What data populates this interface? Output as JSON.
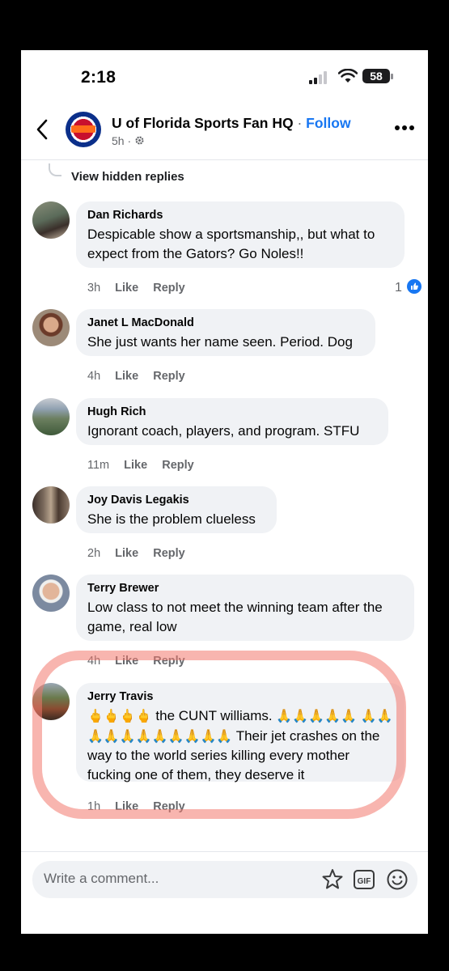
{
  "status_bar": {
    "time": "2:18",
    "battery": "58"
  },
  "header": {
    "page_name": "U of Florida Sports Fan HQ",
    "separator": "·",
    "follow_label": "Follow",
    "post_age": "5h ·"
  },
  "thread": {
    "view_hidden": "View hidden replies"
  },
  "comments": [
    {
      "author": "Dan Richards",
      "text": "Despicable show a sportsmanship,, but what to expect from the Gators? Go Noles!!",
      "time": "3h",
      "like": "Like",
      "reply": "Reply",
      "reactions": "1"
    },
    {
      "author": "Janet L MacDonald",
      "text": "She just wants her name seen. Period. Dog",
      "time": "4h",
      "like": "Like",
      "reply": "Reply"
    },
    {
      "author": "Hugh Rich",
      "text": "Ignorant coach, players, and program.  STFU",
      "time": "11m",
      "like": "Like",
      "reply": "Reply"
    },
    {
      "author": "Joy Davis Legakis",
      "text": "She is the problem clueless",
      "time": "2h",
      "like": "Like",
      "reply": "Reply"
    },
    {
      "author": "Terry Brewer",
      "text": "Low class to not meet the winning team after the game, real low",
      "time": "4h",
      "like": "Like",
      "reply": "Reply"
    },
    {
      "author": "Jerry Travis",
      "fingers": "🖕🖕🖕🖕",
      "text_a": " the CUNT williams. ",
      "prayers_a": "🙏🙏🙏🙏🙏",
      "prayers_b": "🙏🙏🙏🙏🙏🙏🙏🙏🙏🙏🙏",
      "text_b": " Their jet crashes on the way to the world series killing every mother fucking one of them, they deserve it",
      "time": "1h",
      "like": "Like",
      "reply": "Reply"
    }
  ],
  "composer": {
    "placeholder": "Write a comment..."
  },
  "icons": {
    "back": "chevron-left-icon",
    "gear": "gear-icon",
    "more": "more-horizontal-icon",
    "like_badge": "thumbs-up-icon",
    "sticker": "sticker-icon",
    "gif": "gif-icon",
    "emoji": "smiley-icon"
  },
  "colors": {
    "link_blue": "#1877f2",
    "bubble": "#f0f2f5",
    "highlight": "#f2786e"
  }
}
